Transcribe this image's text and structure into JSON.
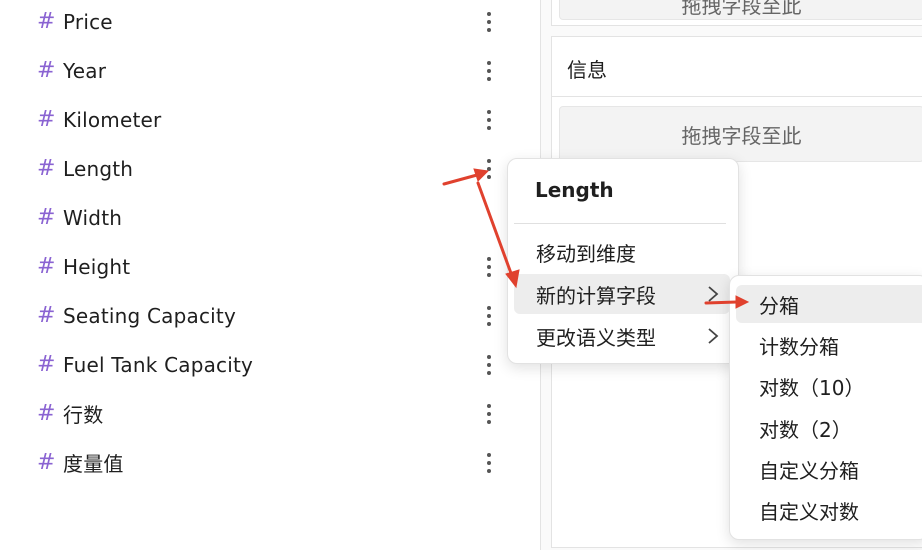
{
  "fields": [
    {
      "label": "Price"
    },
    {
      "label": "Year"
    },
    {
      "label": "Kilometer"
    },
    {
      "label": "Length"
    },
    {
      "label": "Width"
    },
    {
      "label": "Height"
    },
    {
      "label": "Seating Capacity"
    },
    {
      "label": "Fuel Tank Capacity"
    },
    {
      "label": "行数"
    },
    {
      "label": "度量值"
    }
  ],
  "field_type_glyph": "#",
  "right_panel": {
    "top_drop_zone": "拖拽字段至此",
    "section_label": "信息",
    "drop_zone": "拖拽字段至此"
  },
  "context_menu": {
    "title": "Length",
    "items": [
      {
        "label": "移动到维度",
        "has_submenu": false
      },
      {
        "label": "新的计算字段",
        "has_submenu": true
      },
      {
        "label": "更改语义类型",
        "has_submenu": true
      }
    ]
  },
  "submenu": {
    "items": [
      {
        "label": "分箱"
      },
      {
        "label": "计数分箱"
      },
      {
        "label": "对数（10）"
      },
      {
        "label": "对数（2）"
      },
      {
        "label": "自定义分箱"
      },
      {
        "label": "自定义对数"
      }
    ]
  },
  "colors": {
    "hash": "#8a63d2",
    "annotation_arrow": "#e0412e",
    "menu_highlight": "#ededed"
  }
}
